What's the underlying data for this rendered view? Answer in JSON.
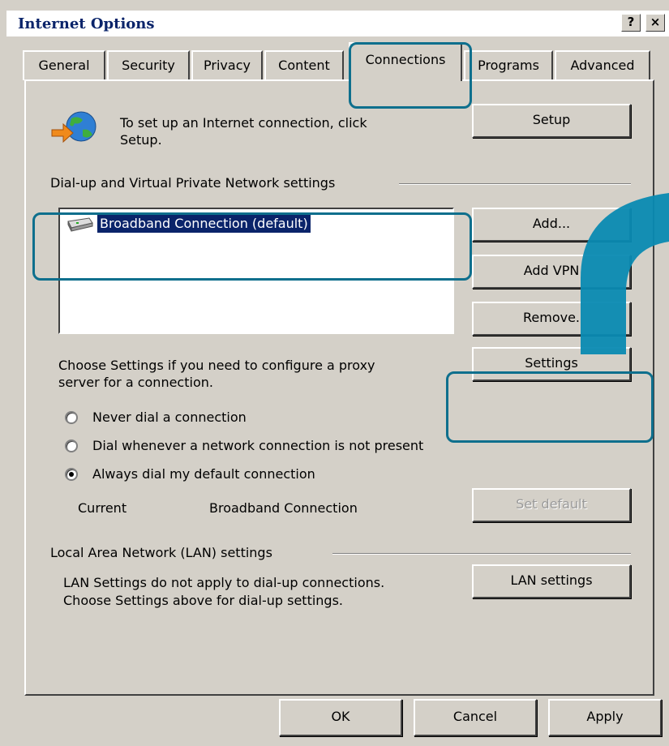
{
  "window": {
    "title": "Internet Options",
    "help_button": "?",
    "close_button": "×"
  },
  "tabs": [
    {
      "label": "General"
    },
    {
      "label": "Security"
    },
    {
      "label": "Privacy"
    },
    {
      "label": "Content"
    },
    {
      "label": "Connections",
      "active": true
    },
    {
      "label": "Programs"
    },
    {
      "label": "Advanced"
    }
  ],
  "setup": {
    "line1": "To set up an Internet connection, click",
    "line2": "Setup.",
    "button": "Setup",
    "icon": "network-globe-icon"
  },
  "dialup": {
    "section_label": "Dial-up and Virtual Private Network settings",
    "connections": [
      {
        "label": "Broadband Connection (default)",
        "selected": true,
        "icon": "modem-icon"
      }
    ],
    "add_button": "Add...",
    "add_vpn_button": "Add VPN",
    "remove_button": "Remove.",
    "proxy_line1": "Choose Settings if you need to configure a proxy",
    "proxy_line2": "server for a connection.",
    "settings_button": "Settings"
  },
  "dial_options": {
    "never": "Never dial a connection",
    "whenever": "Dial whenever a network connection is not present",
    "always": "Always dial my default connection",
    "selected": "always"
  },
  "current": {
    "label": "Current",
    "value": "Broadband Connection",
    "set_default_button": "Set default"
  },
  "lan": {
    "section_label": "Local Area Network (LAN) settings",
    "line1": "LAN Settings do not apply to dial-up connections.",
    "line2": "Choose Settings above for dial-up settings.",
    "button": "LAN settings"
  },
  "footer": {
    "ok": "OK",
    "cancel": "Cancel",
    "apply": "Apply"
  },
  "colors": {
    "dialog_face": "#d4d0c8",
    "selection": "#0a246a",
    "annotation": "#0e6f8d",
    "arrow": "#0a8ab2"
  }
}
